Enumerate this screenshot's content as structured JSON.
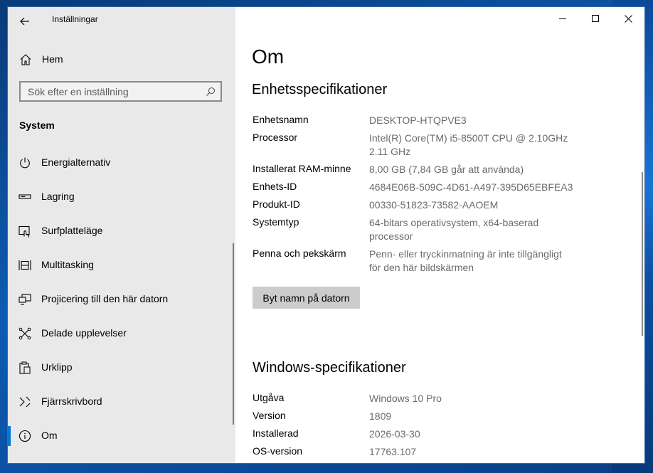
{
  "window": {
    "title": "Inställningar"
  },
  "sidebar": {
    "home_label": "Hem",
    "search_placeholder": "Sök efter en inställning",
    "section_label": "System",
    "items": [
      {
        "label": "Energialternativ",
        "icon": "power-icon",
        "active": false
      },
      {
        "label": "Lagring",
        "icon": "storage-icon",
        "active": false
      },
      {
        "label": "Surfplatteläge",
        "icon": "tablet-mode-icon",
        "active": false
      },
      {
        "label": "Multitasking",
        "icon": "multitasking-icon",
        "active": false
      },
      {
        "label": "Projicering till den här datorn",
        "icon": "projecting-icon",
        "active": false
      },
      {
        "label": "Delade upplevelser",
        "icon": "shared-experiences-icon",
        "active": false
      },
      {
        "label": "Urklipp",
        "icon": "clipboard-icon",
        "active": false
      },
      {
        "label": "Fjärrskrivbord",
        "icon": "remote-desktop-icon",
        "active": false
      },
      {
        "label": "Om",
        "icon": "info-icon",
        "active": true
      }
    ]
  },
  "main": {
    "page_title": "Om",
    "device_specs": {
      "heading": "Enhetsspecifikationer",
      "rows": [
        {
          "label": "Enhetsnamn",
          "value": "DESKTOP-HTQPVE3"
        },
        {
          "label": "Processor",
          "value": "Intel(R) Core(TM) i5-8500T CPU @ 2.10GHz 2.11 GHz"
        },
        {
          "label": "Installerat RAM-minne",
          "value": "8,00 GB (7,84 GB går att använda)"
        },
        {
          "label": "Enhets-ID",
          "value": "4684E06B-509C-4D61-A497-395D65EBFEA3"
        },
        {
          "label": "Produkt-ID",
          "value": "00330-51823-73582-AAOEM"
        },
        {
          "label": "Systemtyp",
          "value": "64-bitars operativsystem, x64-baserad processor"
        },
        {
          "label": "Penna och pekskärm",
          "value": "Penn- eller tryckinmatning är inte tillgängligt för den här bildskärmen"
        }
      ],
      "rename_button": "Byt namn på datorn"
    },
    "windows_specs": {
      "heading": "Windows-specifikationer",
      "rows": [
        {
          "label": "Utgåva",
          "value": "Windows 10 Pro"
        },
        {
          "label": "Version",
          "value": "1809"
        },
        {
          "label": "Installerad",
          "value": "2026-03-30"
        },
        {
          "label": "OS-version",
          "value": "17763.107"
        }
      ]
    }
  },
  "colors": {
    "accent": "#0078d7",
    "sidebar_bg": "#e9e9e9",
    "value_text": "#6b6b6b",
    "button_bg": "#cccccc"
  }
}
